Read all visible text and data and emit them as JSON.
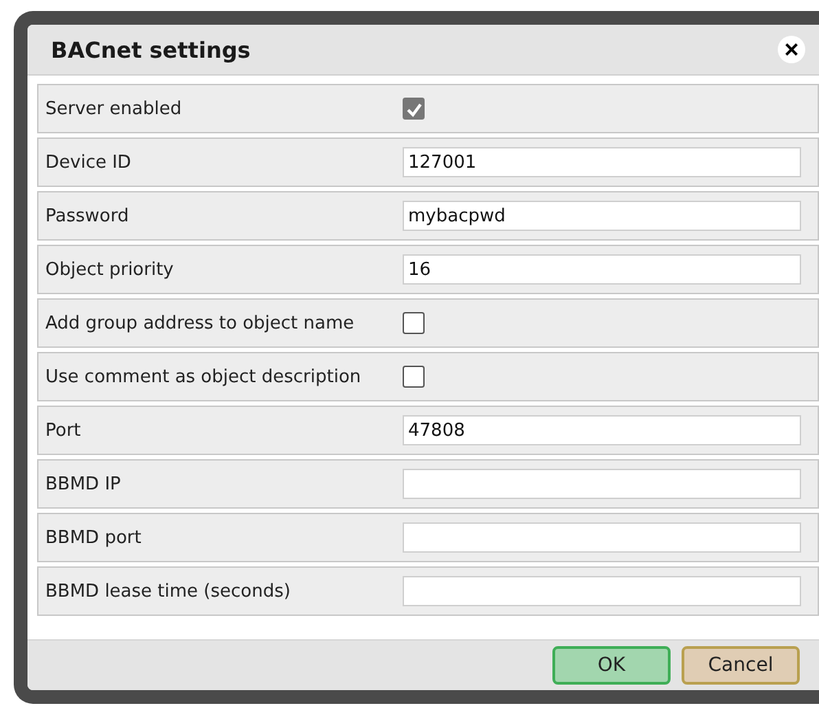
{
  "dialog": {
    "title": "BACnet settings",
    "close": "×"
  },
  "fields": [
    {
      "label": "Server enabled",
      "kind": "checkbox",
      "checked": true
    },
    {
      "label": "Device ID",
      "kind": "text",
      "value": "127001"
    },
    {
      "label": "Password",
      "kind": "text",
      "value": "mybacpwd"
    },
    {
      "label": "Object priority",
      "kind": "text",
      "value": "16"
    },
    {
      "label": "Add group address to object name",
      "kind": "checkbox",
      "checked": false
    },
    {
      "label": "Use comment as object description",
      "kind": "checkbox",
      "checked": false
    },
    {
      "label": "Port",
      "kind": "text",
      "value": "47808"
    },
    {
      "label": "BBMD IP",
      "kind": "text"
    },
    {
      "label": "BBMD port",
      "kind": "text"
    },
    {
      "label": "BBMD lease time (seconds)",
      "kind": "text"
    }
  ],
  "buttons": [
    {
      "label": "OK",
      "kind": "primary"
    },
    {
      "label": "Cancel",
      "kind": "secondary"
    }
  ]
}
